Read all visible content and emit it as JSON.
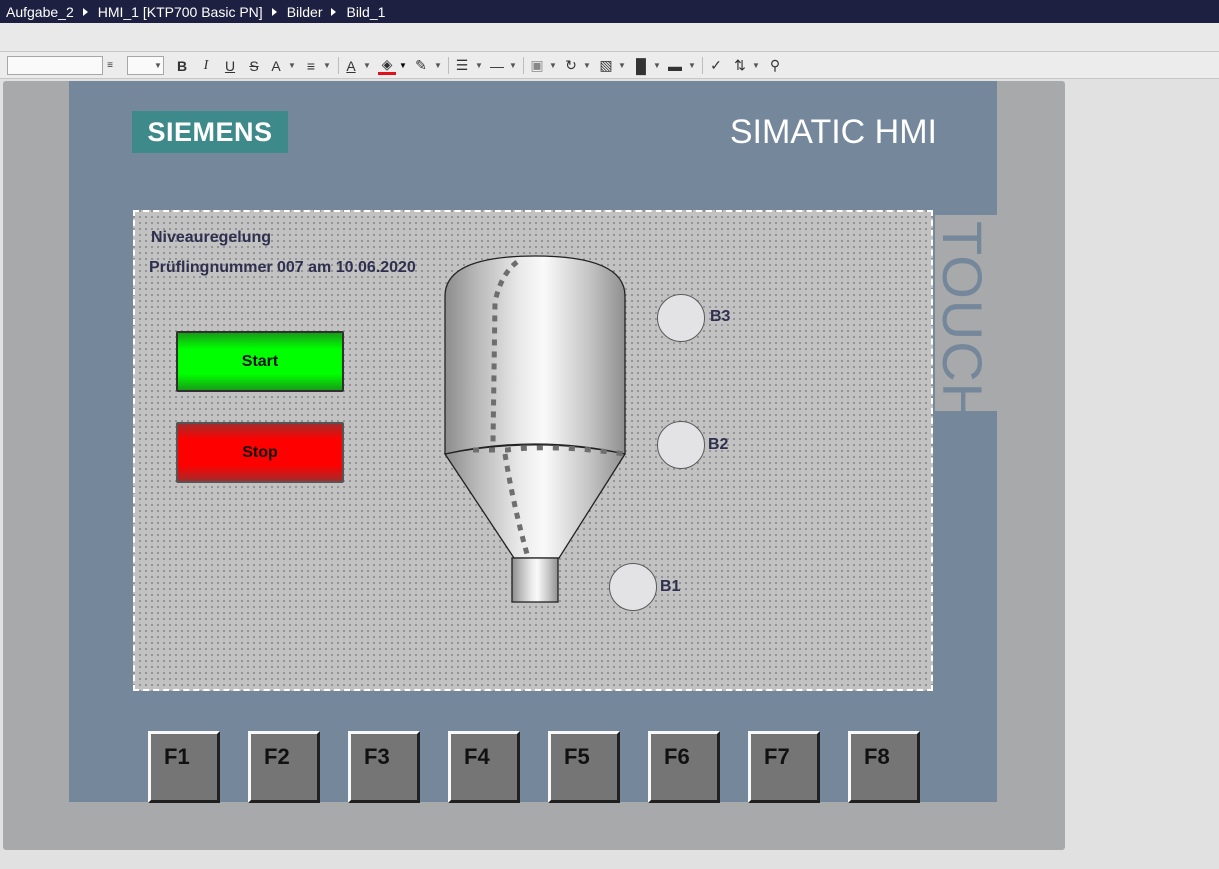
{
  "breadcrumb": [
    "Aufgabe_2",
    "HMI_1 [KTP700 Basic PN]",
    "Bilder",
    "Bild_1"
  ],
  "toolbar": {
    "bold": "B",
    "italic": "I",
    "underline": "U",
    "strikethrough": "S",
    "font_size_up": "A",
    "font_color": "A"
  },
  "device": {
    "brand": "SIEMENS",
    "model_label": "SIMATIC HMI",
    "touch_label": "TOUCH",
    "brand_color": "#3e8a8b",
    "front_color": "#75879a"
  },
  "screen": {
    "title": "Niveauregelung",
    "subtitle": "Prüflingnummer 007 am 10.06.2020",
    "start_label": "Start",
    "stop_label": "Stop",
    "start_color": "#00ff00",
    "stop_color": "#ff0000",
    "sensors": [
      "B3",
      "B2",
      "B1"
    ]
  },
  "function_keys": [
    "F1",
    "F2",
    "F3",
    "F4",
    "F5",
    "F6",
    "F7",
    "F8"
  ]
}
